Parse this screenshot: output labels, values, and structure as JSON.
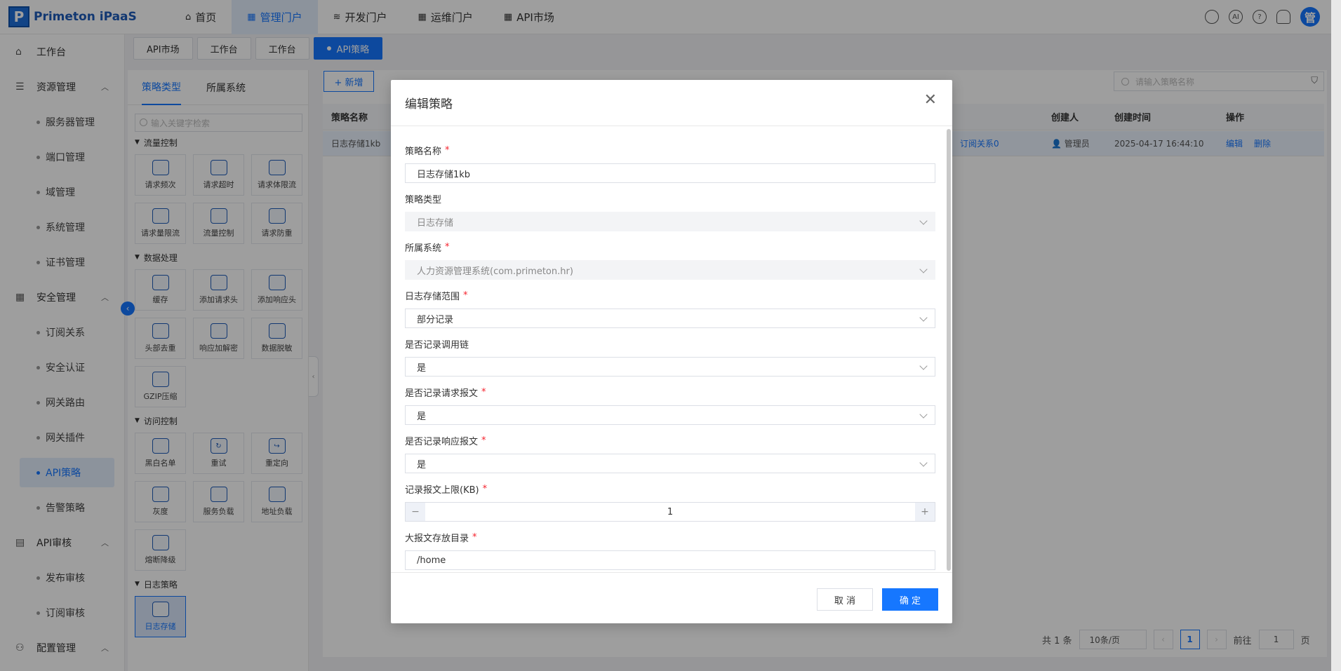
{
  "app": {
    "logo_letter": "P",
    "name": "Primeton iPaaS"
  },
  "topnav": [
    {
      "label": "首页",
      "icon": "home-icon"
    },
    {
      "label": "管理门户",
      "icon": "grid-icon",
      "active": true
    },
    {
      "label": "开发门户",
      "icon": "layers-icon"
    },
    {
      "label": "运维门户",
      "icon": "grid-icon"
    },
    {
      "label": "API市场",
      "icon": "grid-icon"
    }
  ],
  "top_right": {
    "ai_label": "AI",
    "help": "?",
    "avatar": "管"
  },
  "sidebar": {
    "workbench": "工作台",
    "groups": [
      {
        "label": "资源管理",
        "items": [
          "服务器管理",
          "端口管理",
          "域管理",
          "系统管理",
          "证书管理"
        ]
      },
      {
        "label": "安全管理",
        "items": [
          "订阅关系",
          "安全认证",
          "网关路由",
          "网关插件",
          "API策略",
          "告警策略"
        ]
      },
      {
        "label": "API审核",
        "items": [
          "发布审核",
          "订阅审核"
        ]
      },
      {
        "label": "配置管理",
        "items": []
      }
    ]
  },
  "page_tabs": [
    "API市场",
    "工作台",
    "工作台",
    "API策略"
  ],
  "left_panel": {
    "tabs": [
      "策略类型",
      "所属系统"
    ],
    "search_placeholder": "输入关键字检索",
    "categories": [
      {
        "label": "流量控制",
        "items": [
          "请求频次",
          "请求超时",
          "请求体限流",
          "请求量限流",
          "流量控制",
          "请求防重"
        ]
      },
      {
        "label": "数据处理",
        "items": [
          "缓存",
          "添加请求头",
          "添加响应头",
          "头部去重",
          "响应加解密",
          "数据脱敏",
          "GZIP压缩"
        ]
      },
      {
        "label": "访问控制",
        "items": [
          "黑白名单",
          "重试",
          "重定向",
          "灰度",
          "服务负载",
          "地址负载",
          "熔断降级"
        ]
      },
      {
        "label": "日志策略",
        "items": [
          "日志存储"
        ]
      }
    ]
  },
  "main": {
    "add_button": "+ 新增",
    "search_placeholder": "请输入策略名称",
    "columns": {
      "name": "策略名称",
      "creator": "创建人",
      "created": "创建时间",
      "ops": "操作"
    },
    "row": {
      "name": "日志存储1kb",
      "subscription": "订阅关系0",
      "creator": "管理员",
      "created": "2025-04-17 16:44:10",
      "edit": "编辑",
      "delete": "删除"
    },
    "pager": {
      "total": "共 1 条",
      "page_size": "10条/页",
      "current": "1",
      "goto_label": "前往",
      "goto_value": "1",
      "page_unit": "页"
    }
  },
  "modal": {
    "title": "编辑策略",
    "fields": {
      "name": {
        "label": "策略名称",
        "value": "日志存储1kb"
      },
      "type": {
        "label": "策略类型",
        "value": "日志存储"
      },
      "system": {
        "label": "所属系统",
        "value": "人力资源管理系统(com.primeton.hr)"
      },
      "scope": {
        "label": "日志存储范围",
        "value": "部分记录"
      },
      "chain": {
        "label": "是否记录调用链",
        "value": "是"
      },
      "req": {
        "label": "是否记录请求报文",
        "value": "是"
      },
      "resp": {
        "label": "是否记录响应报文",
        "value": "是"
      },
      "limit": {
        "label": "记录报文上限(KB)",
        "value": "1"
      },
      "dir": {
        "label": "大报文存放目录",
        "value": "/home"
      }
    },
    "required_mark": "*",
    "cancel": "取 消",
    "ok": "确 定"
  },
  "colors": {
    "accent": "#1677ff",
    "required": "#f5222d"
  }
}
